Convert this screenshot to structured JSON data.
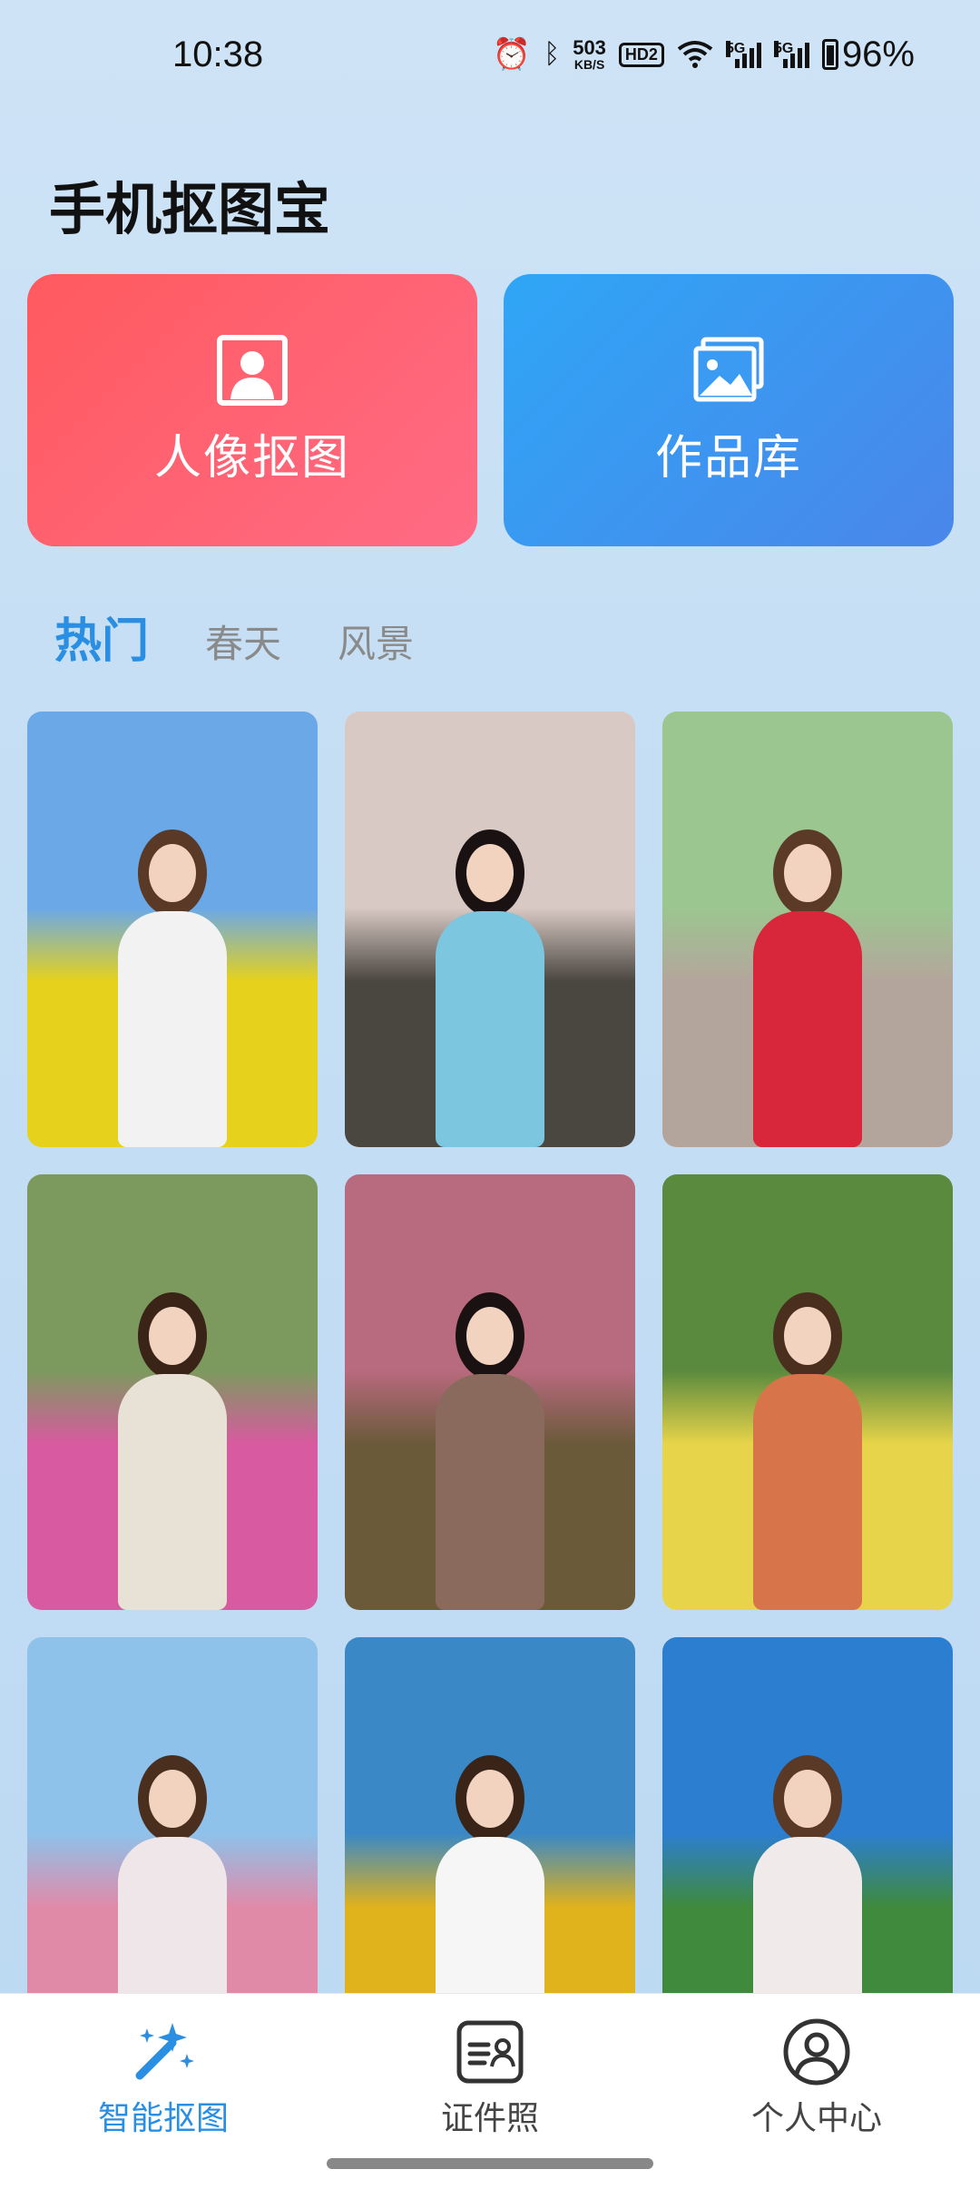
{
  "status_bar": {
    "time": "10:38",
    "net_speed_value": "503",
    "net_speed_unit": "KB/S",
    "hd_badge": "HD2",
    "sim1_label": "5G",
    "sim2_label": "5G",
    "battery_percent": "96%",
    "icons": [
      "alarm-icon",
      "bluetooth-icon",
      "wifi-icon",
      "signal-icon",
      "battery-icon"
    ]
  },
  "app": {
    "title": "手机抠图宝"
  },
  "features": [
    {
      "label": "人像抠图",
      "icon": "portrait-icon",
      "color": "#ff5e6c"
    },
    {
      "label": "作品库",
      "icon": "gallery-icon",
      "color": "#3b9af1"
    }
  ],
  "tabs": [
    {
      "label": "热门",
      "active": true
    },
    {
      "label": "春天",
      "active": false
    },
    {
      "label": "风景",
      "active": false
    }
  ],
  "accent_color": "#2a8fe3",
  "photos": [
    {
      "name": "photo-rapeseed-field",
      "sky": "#6aa8e8",
      "ground": "#e6d21c",
      "dress": "#f2f2f2",
      "hair": "#5a3a26"
    },
    {
      "name": "photo-castle-garden",
      "sky": "#d9c9c4",
      "ground": "#4a4640",
      "dress": "#7cc6e0",
      "hair": "#1a1212"
    },
    {
      "name": "photo-tulip-path",
      "sky": "#9cc690",
      "ground": "#b4a59c",
      "dress": "#d8263a",
      "hair": "#5c3a28"
    },
    {
      "name": "photo-lupine-flowers",
      "sky": "#7c9a5e",
      "ground": "#d85aa0",
      "dress": "#e8e2d6",
      "hair": "#3a2418"
    },
    {
      "name": "photo-cherry-tree-bridge",
      "sky": "#b86a7e",
      "ground": "#6a5a3a",
      "dress": "#8a6a5c",
      "hair": "#1a1212"
    },
    {
      "name": "photo-yellow-tulips",
      "sky": "#5a8a3e",
      "ground": "#e8d44a",
      "dress": "#d8744a",
      "hair": "#4a2e1e"
    },
    {
      "name": "photo-cherry-blossom-veil",
      "sky": "#8ec2ea",
      "ground": "#e08aa8",
      "dress": "#efe6ea",
      "hair": "#4a2e1e"
    },
    {
      "name": "photo-bride-sunflowers",
      "sky": "#3a88c6",
      "ground": "#e0b21c",
      "dress": "#f6f6f6",
      "hair": "#3a2418"
    },
    {
      "name": "photo-palm-fairy",
      "sky": "#2c7ed0",
      "ground": "#3f8a3c",
      "dress": "#f0eaea",
      "hair": "#5a3a26"
    }
  ],
  "bottom_nav": [
    {
      "label": "智能抠图",
      "icon": "magic-wand-icon",
      "active": true
    },
    {
      "label": "证件照",
      "icon": "id-card-icon",
      "active": false
    },
    {
      "label": "个人中心",
      "icon": "user-circle-icon",
      "active": false
    }
  ]
}
